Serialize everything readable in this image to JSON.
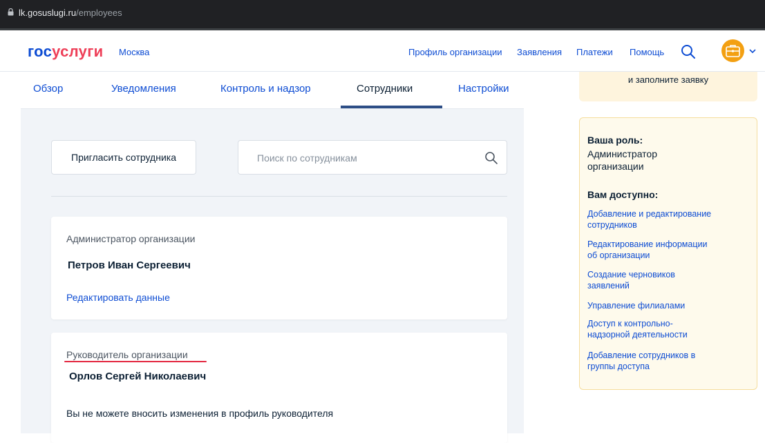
{
  "browser": {
    "url_host": "lk.gosuslugi.ru",
    "url_path": "/employees"
  },
  "header": {
    "logo_part1": "гос",
    "logo_part2": "услуги",
    "city": "Москва",
    "nav": [
      "Профиль организации",
      "Заявления",
      "Платежи",
      "Помощь"
    ]
  },
  "tabs": [
    {
      "label": "Обзор",
      "active": false
    },
    {
      "label": "Уведомления",
      "active": false
    },
    {
      "label": "Контроль и надзор",
      "active": false
    },
    {
      "label": "Сотрудники",
      "active": true
    },
    {
      "label": "Настройки",
      "active": false
    }
  ],
  "toolbar": {
    "invite_label": "Пригласить сотрудника",
    "search_placeholder": "Поиск по сотрудникам"
  },
  "employees": [
    {
      "role": "Администратор организации",
      "name": "Петров Иван Сергеевич",
      "action": "Редактировать данные"
    },
    {
      "role": "Руководитель организации",
      "name": "Орлов Сергей Николаевич",
      "note": "Вы не можете вносить изменения в профиль руководителя"
    }
  ],
  "sidebar": {
    "notice_text": "и заполните заявку",
    "role_heading": "Ваша роль:",
    "role_line1": "Администратор",
    "role_line2": "организации",
    "access_heading": "Вам доступно:",
    "permissions": [
      [
        "Добавление и редактирование",
        "сотрудников"
      ],
      [
        "Редактирование информации",
        "об организации"
      ],
      [
        "Создание черновиков",
        "заявлений"
      ],
      [
        "Управление филиалами"
      ],
      [
        "Доступ к контрольно-",
        "надзорной деятельности"
      ],
      [
        "Добавление сотрудников в",
        "группы доступа"
      ]
    ]
  },
  "colors": {
    "brand_blue": "#0d4cd3",
    "brand_red": "#ee3f58",
    "avatar_orange": "#f3a012",
    "highlight_red": "#e3263f"
  }
}
